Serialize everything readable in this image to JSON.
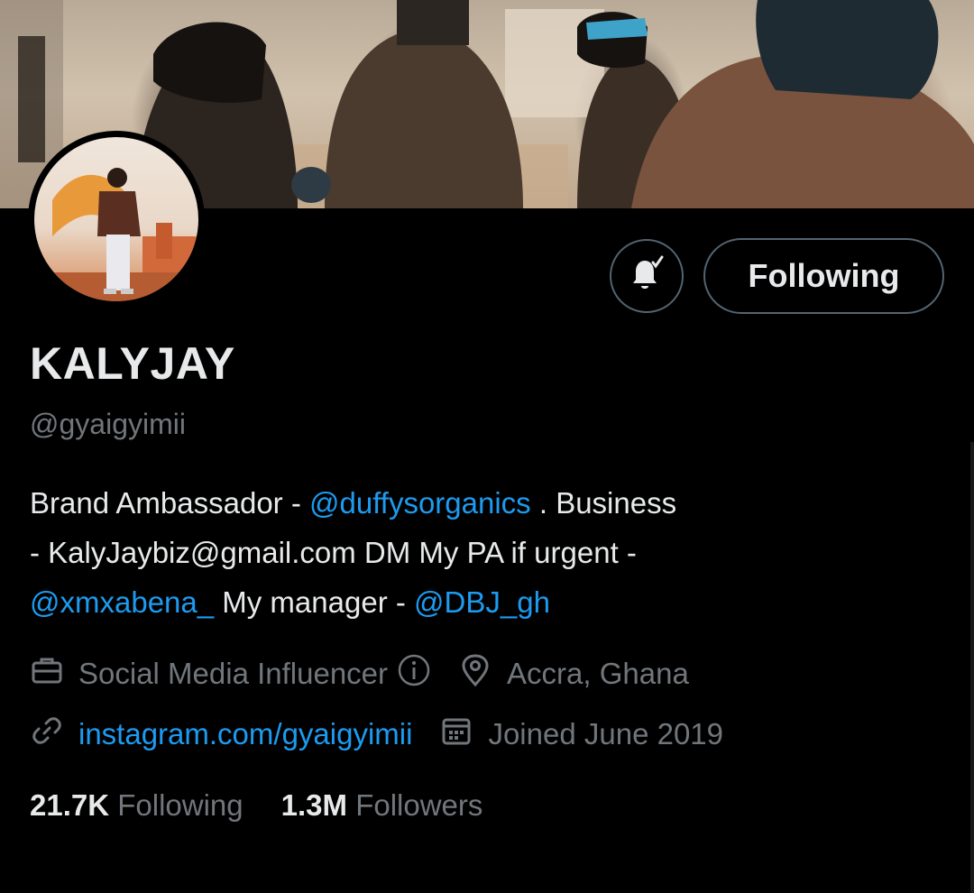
{
  "profile": {
    "name": "KALYJAY",
    "handle": "@gyaigyimii",
    "follow_label": "Following",
    "bio": {
      "l1_a": "Brand Ambassador - ",
      "l1_mention": "@duffysorganics",
      "l1_b": " . Business",
      "l2": "- KalyJaybiz@gmail.com DM My PA if urgent -",
      "l3_mention1": "@xmxabena_",
      "l3_mid": " My manager - ",
      "l3_mention2": "@DBJ_gh"
    },
    "category": "Social Media Influencer",
    "location": "Accra, Ghana",
    "website": "instagram.com/gyaigyimii",
    "joined": "Joined June 2019",
    "stats": {
      "following_count": "21.7K",
      "following_label": "Following",
      "followers_count": "1.3M",
      "followers_label": "Followers"
    }
  },
  "icons": {
    "notifications": "bell-check-icon",
    "category": "briefcase-icon",
    "info": "info-icon",
    "location": "location-pin-icon",
    "website": "link-icon",
    "joined": "calendar-icon"
  },
  "colors": {
    "background": "#000000",
    "text": "#e7e9ea",
    "muted": "#71767b",
    "link": "#1d9bf0",
    "border": "#536471"
  }
}
